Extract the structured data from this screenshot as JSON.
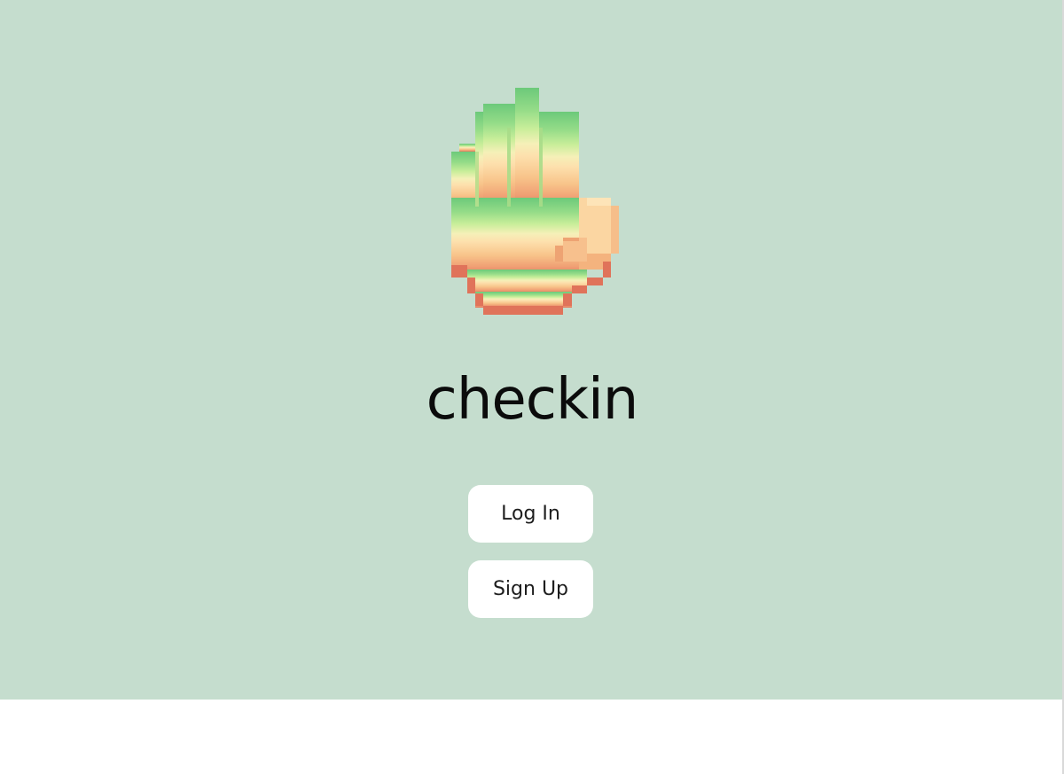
{
  "app": {
    "title": "checkin",
    "logo_icon": "waving-hand-icon"
  },
  "buttons": {
    "login_label": "Log In",
    "signup_label": "Sign Up"
  },
  "colors": {
    "background": "#c5ddce",
    "button_bg": "#ffffff",
    "text": "#0b0b0b"
  }
}
